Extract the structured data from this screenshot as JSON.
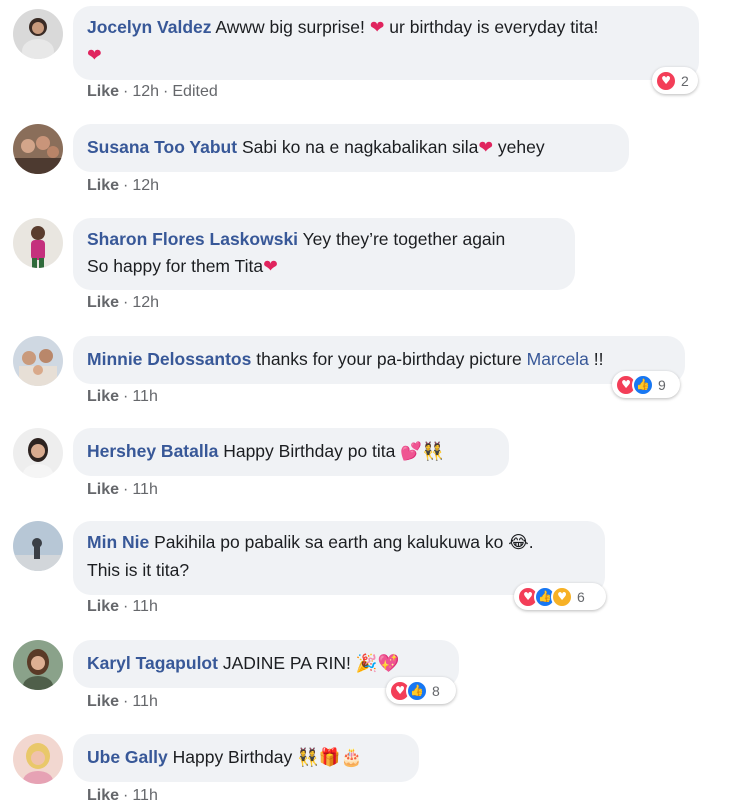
{
  "labels": {
    "like": "Like"
  },
  "comments": [
    {
      "name": "Jocelyn Valdez",
      "text_before": "Awww big surprise! ",
      "heart_mid": "❤",
      "text_after": " ur birthday is everyday tita!",
      "heart_end": "❤",
      "time": "12h",
      "edited": "Edited",
      "reaction_count": "2"
    },
    {
      "name": "Susana Too Yabut",
      "text_before": "Sabi ko na e nagkabalikan sila",
      "heart_mid": "❤",
      "text_after": " yehey",
      "time": "12h"
    },
    {
      "name": "Sharon Flores Laskowski",
      "line1": "Yey they’re together again",
      "line2": "So happy for them Tita",
      "heart_end": "❤",
      "time": "12h"
    },
    {
      "name": "Minnie Delossantos",
      "text_before": "thanks for your pa-birthday picture ",
      "tag": "Marcela",
      "text_after": " !!",
      "time": "11h",
      "reaction_count": "9"
    },
    {
      "name": "Hershey Batalla",
      "text_before": "Happy Birthday po tita ",
      "emoji": "💕👯",
      "time": "11h"
    },
    {
      "name": "Min Nie",
      "line1": "Pakihila po pabalik sa earth ang kalukuwa ko ",
      "emoji": "😂",
      "line1_end": ".",
      "line2": "This is it tita?",
      "time": "11h",
      "reaction_count": "6"
    },
    {
      "name": "Karyl Tagapulot",
      "text_before": "JADINE PA RIN! ",
      "emoji": "🎉💖",
      "time": "11h",
      "reaction_count": "8"
    },
    {
      "name": "Ube Gally",
      "text_before": "Happy Birthday ",
      "emoji": "👯🎁🎂",
      "time": "11h"
    }
  ],
  "colors": {
    "name": "#385898",
    "bubble": "#f0f2f5",
    "heart": "#e0245e",
    "love": "#f33e58",
    "like": "#1877f2",
    "care": "#f7b125"
  }
}
